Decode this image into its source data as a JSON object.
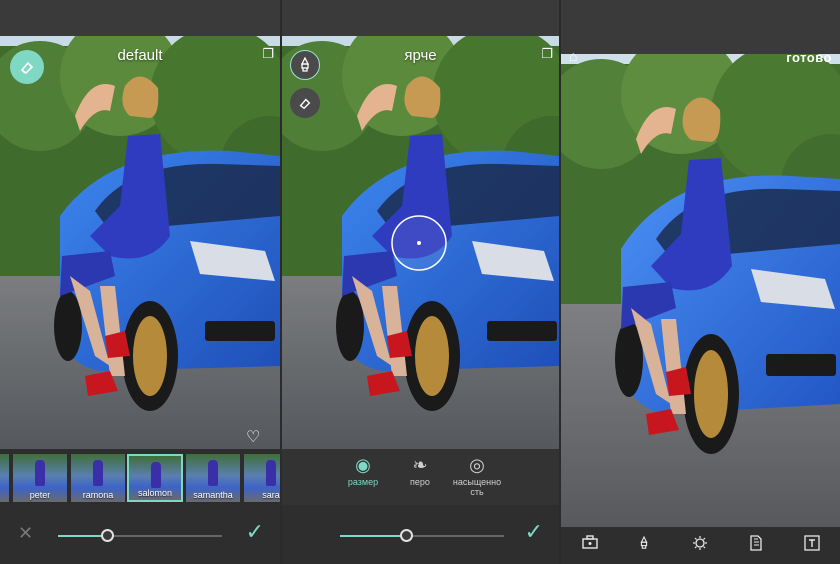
{
  "colors": {
    "accent": "#7fd8c4",
    "dress": "#2f3cc0",
    "car": "#2a6fe0"
  },
  "panel1": {
    "title": "default",
    "compare_icon": "compare-icon",
    "eraser_icon": "eraser-icon",
    "heart_icon": "heart-icon",
    "filters": [
      {
        "label": ""
      },
      {
        "label": "peter"
      },
      {
        "label": "ramona"
      },
      {
        "label": "salomon",
        "selected": true
      },
      {
        "label": "samantha"
      },
      {
        "label": "sara"
      }
    ],
    "slider_value": 0.3,
    "cancel_icon": "close-icon",
    "apply_icon": "checkmark-icon"
  },
  "panel2": {
    "title": "ярче",
    "compare_icon": "compare-icon",
    "brush_icon": "brush-icon",
    "eraser_icon": "eraser-icon",
    "tools": [
      {
        "label": "размер",
        "icon": "size-icon",
        "active": true
      },
      {
        "label": "перо",
        "icon": "feather-icon",
        "active": false
      },
      {
        "label": "насыщенно\nсть",
        "icon": "saturation-icon",
        "active": false
      }
    ],
    "slider_value": 0.4,
    "apply_icon": "checkmark-icon"
  },
  "panel3": {
    "home_icon": "home-icon",
    "done_label": "готово",
    "bottom_icons": [
      "toolbox-icon",
      "brush-icon",
      "effects-icon",
      "sticker-icon",
      "text-icon"
    ]
  }
}
